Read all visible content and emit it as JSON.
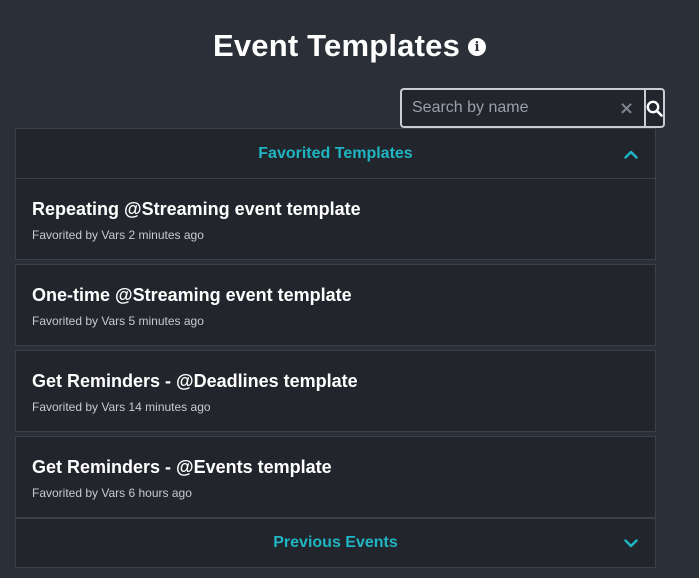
{
  "header": {
    "title": "Event Templates",
    "info_icon": "info-icon"
  },
  "search": {
    "placeholder": "Search by name",
    "value": "",
    "clear_icon": "×",
    "search_icon": "search-icon"
  },
  "favorited": {
    "label": "Favorited Templates",
    "expanded": true,
    "items": [
      {
        "title": "Repeating @Streaming event template",
        "meta": "Favorited by Vars 2 minutes ago"
      },
      {
        "title": "One-time @Streaming event template",
        "meta": "Favorited by Vars 5 minutes ago"
      },
      {
        "title": "Get Reminders - @Deadlines template",
        "meta": "Favorited by Vars 14 minutes ago"
      },
      {
        "title": "Get Reminders - @Events template",
        "meta": "Favorited by Vars 6 hours ago"
      }
    ]
  },
  "previous": {
    "label": "Previous Events",
    "expanded": false
  },
  "colors": {
    "background": "#2b2f38",
    "panel": "#22252c",
    "accent": "#1fb5c2",
    "text": "#ffffff"
  }
}
